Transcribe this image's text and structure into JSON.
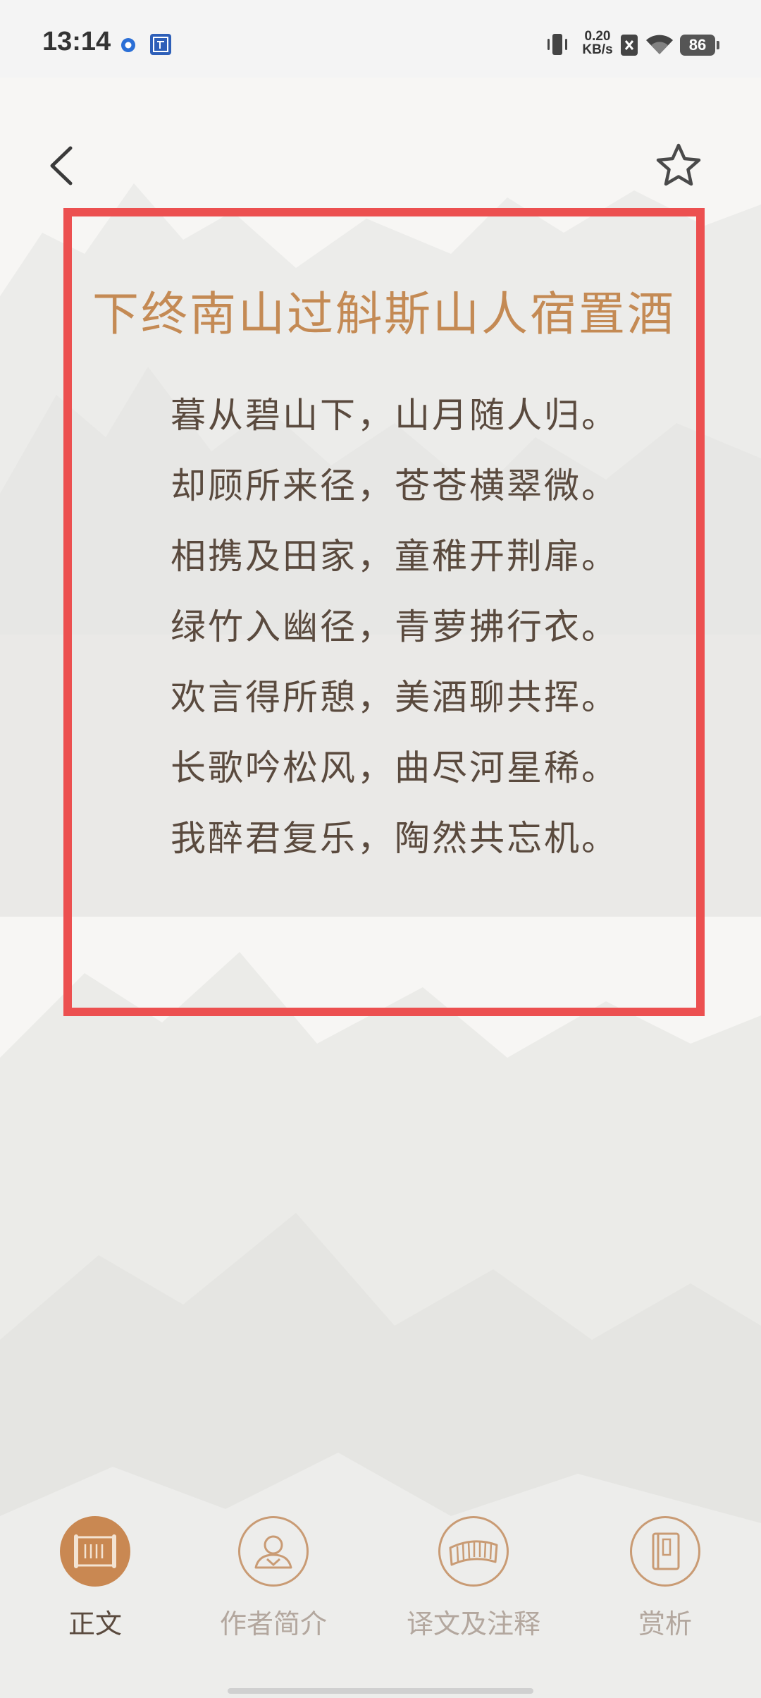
{
  "status_bar": {
    "time": "13:14",
    "net_speed_value": "0.20",
    "net_speed_unit": "KB/s",
    "battery": "86"
  },
  "header": {
    "back_icon": "chevron-left-icon",
    "favorite_icon": "star-outline-icon"
  },
  "poem": {
    "title": "下终南山过斛斯山人宿置酒",
    "lines": [
      "暮从碧山下，山月随人归。",
      "却顾所来径，苍苍横翠微。",
      "相携及田家，童稚开荆扉。",
      "绿竹入幽径，青萝拂行衣。",
      "欢言得所憩，美酒聊共挥。",
      "长歌吟松风，曲尽河星稀。",
      "我醉君复乐，陶然共忘机。"
    ],
    "highlight_color": "#ec5050",
    "title_color": "#c48a54"
  },
  "bottom_nav": {
    "accent": "#c98852",
    "items": [
      {
        "label": "正文",
        "icon": "scroll-icon",
        "active": true
      },
      {
        "label": "作者简介",
        "icon": "author-icon",
        "active": false
      },
      {
        "label": "译文及注释",
        "icon": "bamboo-slip-icon",
        "active": false
      },
      {
        "label": "赏析",
        "icon": "book-icon",
        "active": false
      }
    ]
  }
}
